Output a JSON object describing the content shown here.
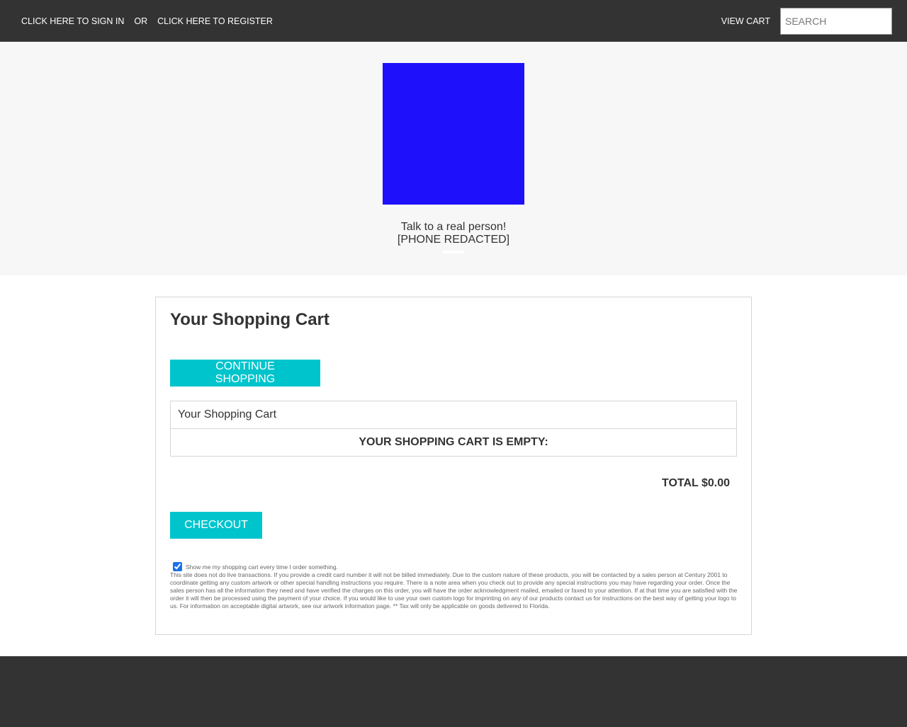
{
  "topbar": {
    "sign_in_label": "CLICK HERE TO SIGN IN",
    "or_label": "OR",
    "register_label": "CLICK HERE TO REGISTER",
    "view_cart_label": "VIEW CART",
    "search_placeholder": "SEARCH"
  },
  "header": {
    "contact_line1": "Talk to a real person!",
    "contact_line2": "[PHONE REDACTED]",
    "logo_color": "#1e10fa"
  },
  "cart": {
    "title": "Your Shopping Cart",
    "continue_label": "CONTINUE SHOPPING",
    "table_header": "Your Shopping Cart",
    "empty_message": "YOUR SHOPPING CART IS EMPTY:",
    "total_label": "TOTAL $0.00",
    "checkout_label": "CHECKOUT",
    "show_cart_checked": true,
    "show_cart_label": "Show me my shopping cart every time I order something.",
    "disclaimer": "This site does not do live transactions. If you provide a credit card number it will not be billed immediately. Due to the custom nature of these products, you will be contacted by a sales person at Century 2001 to coordinate getting any custom artwork or other special handling instructions you require. There is a note area when you check out to provide any special instructions you may have regarding your order. Once the sales person has all the information they need and have verified the charges on this order, you will have the order acknowledgment mailed, emailed or faxed to your attention. If at that time you are satisfied with the order it will then be processed using the payment of your choice. If you would like to use your own custom logo for imprinting on any of our products contact us for instructions on the best way of getting your logo to us. For information on acceptable digital artwork, see our artwork information page. ** Tax will only be applicable on goods delivered to Florida."
  },
  "colors": {
    "topbar_bg": "#333333",
    "header_bg": "#f7f7f7",
    "accent": "#00c4cc",
    "footer_bg": "#333333"
  }
}
